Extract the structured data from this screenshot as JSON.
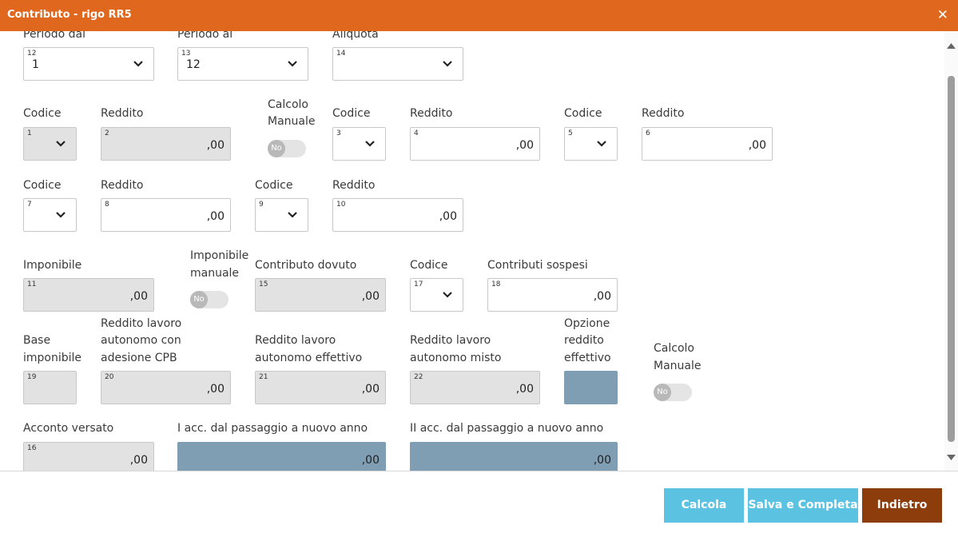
{
  "window": {
    "title": "Contributo - rigo RR5",
    "close_glyph": "✕"
  },
  "labels": {
    "periodo_dal": "Periodo dal",
    "periodo_al": "Periodo al",
    "aliquota": "Aliquota",
    "codice": "Codice",
    "reddito": "Reddito",
    "calcolo_manuale_1": "Calcolo",
    "calcolo_manuale_2": "Manuale",
    "imponibile": "Imponibile",
    "imponibile_manuale_1": "Imponibile",
    "imponibile_manuale_2": "manuale",
    "contributo_dovuto": "Contributo dovuto",
    "contributi_sospesi": "Contributi sospesi",
    "base_imponibile_1": "Base",
    "base_imponibile_2": "imponibile",
    "rla_cpb_1": "Reddito lavoro",
    "rla_cpb_2": "autonomo con",
    "rla_cpb_3": "adesione CPB",
    "rla_eff_1": "Reddito lavoro",
    "rla_eff_2": "autonomo effettivo",
    "rla_misto_1": "Reddito lavoro",
    "rla_misto_2": "autonomo misto",
    "opzione_1": "Opzione",
    "opzione_2": "reddito",
    "opzione_3": "effettivo",
    "acconto_versato": "Acconto versato",
    "i_acc": "I acc. dal passaggio a nuovo anno",
    "ii_acc": "II acc. dal passaggio a nuovo anno"
  },
  "fields": {
    "f12": {
      "num": "12",
      "value": "1"
    },
    "f13": {
      "num": "13",
      "value": "12"
    },
    "f14": {
      "num": "14",
      "value": ""
    },
    "f1": {
      "num": "1"
    },
    "f2": {
      "num": "2",
      "value": ",00"
    },
    "f3": {
      "num": "3"
    },
    "f4": {
      "num": "4",
      "value": ",00"
    },
    "f5": {
      "num": "5"
    },
    "f6": {
      "num": "6",
      "value": ",00"
    },
    "f7": {
      "num": "7"
    },
    "f8": {
      "num": "8",
      "value": ",00"
    },
    "f9": {
      "num": "9"
    },
    "f10": {
      "num": "10",
      "value": ",00"
    },
    "f11": {
      "num": "11",
      "value": ",00"
    },
    "f15": {
      "num": "15",
      "value": ",00"
    },
    "f17": {
      "num": "17"
    },
    "f18": {
      "num": "18",
      "value": ",00"
    },
    "f19": {
      "num": "19"
    },
    "f20": {
      "num": "20",
      "value": ",00"
    },
    "f21": {
      "num": "21",
      "value": ",00"
    },
    "f22": {
      "num": "22",
      "value": ",00"
    },
    "f16": {
      "num": "16",
      "value": ",00"
    },
    "iacc": {
      "value": ",00"
    },
    "iiacc": {
      "value": ",00"
    }
  },
  "toggles": {
    "off_label": "No"
  },
  "buttons": {
    "calcola": "Calcola",
    "salva": "Salva e Completa",
    "indietro": "Indietro"
  },
  "colors": {
    "header": "#e0671e",
    "button_light": "#5bc2e1",
    "button_dark": "#8d3c0c",
    "computed_field": "#7f9db3"
  }
}
